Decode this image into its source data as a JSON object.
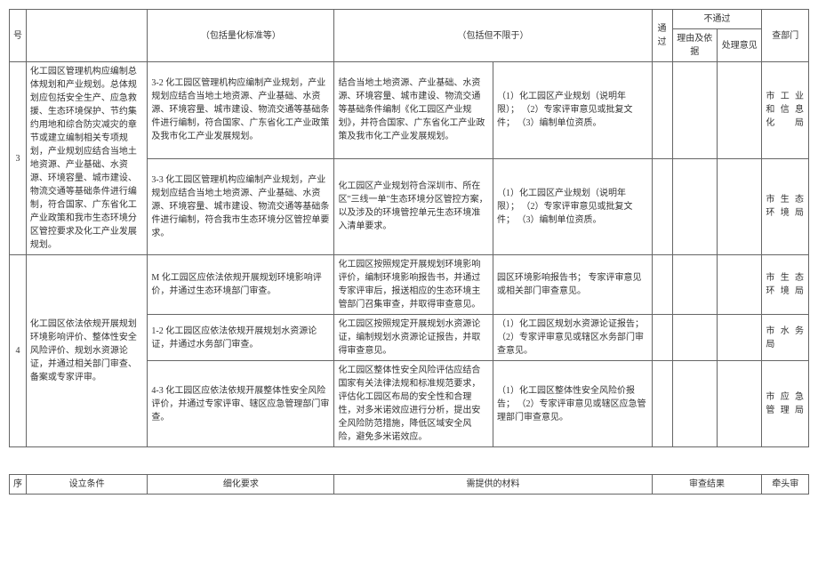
{
  "header": {
    "col1": "号",
    "col2": "",
    "col3": "（包括量化标准等）",
    "col4": "（包括但不限于）",
    "col5": "通过",
    "not_pass": "不通过",
    "reason": "理由及依据",
    "opinion": "处理意见",
    "dept": "查部门"
  },
  "rows": [
    {
      "num": "3",
      "cond": "化工园区管理机构应编制总体规划和产业规划。总体规划应包括安全生产、应急救援、生态环境保护、节约集约用地和综合防灾减灾的章节或建立编制相关专项规划，产业规划应结合当地土地资源、产业基础、水资源、环境容量、城市建设、物流交通等基础条件进行编制，符合国家、广东省化工产业政策和我市生态环境分区管控要求及化工产业发展规划。",
      "sub": [
        {
          "detail": "3-2 化工园区管理机构应编制产业规划，产业规划应结合当地土地资源、产业基础、水资源、环境容量、城市建设、物流交通等基础条件进行编制，符合国家、广东省化工产业政策及我市化工产业发展规划。",
          "mat": "结合当地土地资源、产业基础、水资源、环境容量、城市建设、物流交通等基础条件编制《化工园区产业规划》，并符合国家、广东省化工产业政策及我市化工产业发展规划。",
          "need": "（1）化工园区产业规划（说明年限）；\n（2）专家评审意见或批复文件；\n（3）编制单位资质。",
          "dept": "市工业和信息化局"
        },
        {
          "detail": "3-3 化工园区管理机构应编制产业规划，产业规划应结合当地土地资源、产业基础、水资源、环境容量、城市建设、物流交通等基础条件进行编制，符合我市生态环境分区管控单要求。",
          "mat": "化工园区产业规划符合深圳市、所在区\"三线一单\"生态环境分区管控方案，以及涉及的环境管控单元生态环境准入清单要求。",
          "need": "（1）化工园区产业规划（说明年限）；\n（2）专家评审意见或批复文件；\n（3）编制单位资质。",
          "dept": "市生态环境局"
        }
      ]
    },
    {
      "num": "4",
      "cond": "化工园区依法依规开展规划环境影响评价、整体性安全风险评价、规划水资源论证，并通过相关部门审查、备案或专家评审。",
      "sub": [
        {
          "detail": "M 化工园区应依法依规开展规划环境影响评价，并通过生态环境部门审查。",
          "mat": "化工园区按照规定开展规划环境影响评价，编制环境影响报告书，并通过专家评审后，报送相应的生态环境主管部门召集审查，并取得审查意见。",
          "need": "园区环境影响报告书；\n专家评审意见或相关部门审查意见。",
          "dept": "市生态环境局"
        },
        {
          "detail": "1-2 化工园区应依法依规开展规划水资源论证，并通过水务部门审查。",
          "mat": "化工园区按照规定开展规划水资源论证，编制规划水资源论证报告，并取得审查意见。",
          "need": "（1）化工园区规划水资源论证报告；\n（2）专家评审意见或辖区水务部门审查意见。",
          "dept": "市水务局"
        },
        {
          "detail": "4-3 化工园区应依法依规开展整体性安全风险评价，并通过专家评审、辖区应急管理部门审查。",
          "mat": "化工园区整体性安全风险评估应结合国家有关法律法规和标准规范要求，评估化工园区布局的安全性和合理性，对多米诺效应进行分析，提出安全风险防范措施，降低区域安全风险，避免多米诺效应。",
          "need": "（1）化工园区整体性安全风险价报告；\n（2）专家评审意见或辖区应急管理部门审查意见。",
          "dept": "市应急管理局"
        }
      ]
    }
  ],
  "footer": {
    "c1": "序",
    "c2": "设立条件",
    "c3": "细化要求",
    "c4": "需提供的材料",
    "c5": "审查结果",
    "c6": "牵头审"
  }
}
